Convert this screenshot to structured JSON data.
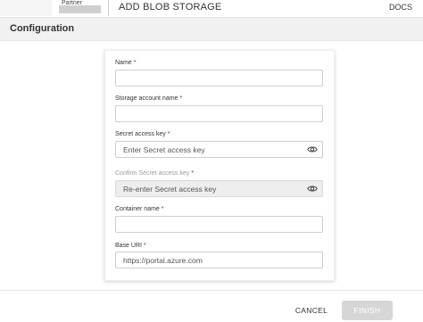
{
  "header": {
    "partner_label": "Partner",
    "title": "ADD BLOB STORAGE",
    "docs_label": "DOCS"
  },
  "section": {
    "title": "Configuration"
  },
  "form": {
    "name": {
      "label": "Name",
      "required_mark": "*",
      "value": "",
      "placeholder": ""
    },
    "storage_account": {
      "label": "Storage account name",
      "required_mark": "*",
      "value": "",
      "placeholder": ""
    },
    "secret_key": {
      "label": "Secret access key",
      "required_mark": "*",
      "placeholder": "Enter Secret access key",
      "eye_icon": "eye-icon"
    },
    "confirm_secret_key": {
      "label": "Confirm Secret access key",
      "required_mark": "*",
      "placeholder": "Re-enter Secret access key",
      "disabled": true,
      "eye_icon": "eye-icon"
    },
    "container": {
      "label": "Container name",
      "required_mark": "*",
      "value": "",
      "placeholder": ""
    },
    "base_uri": {
      "label": "Base URI",
      "required_mark": "*",
      "value": "https://portal.azure.com"
    }
  },
  "footer": {
    "cancel_label": "CANCEL",
    "finish_label": "FINISH",
    "finish_disabled": true
  },
  "colors": {
    "required": "#d0021b",
    "disabled_button": "#d6d6d6",
    "section_bg": "#f1f1f1"
  }
}
